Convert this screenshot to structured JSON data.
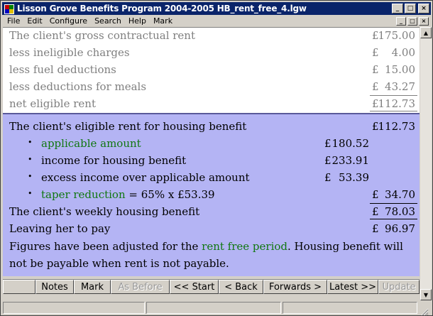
{
  "window": {
    "title": "Lisson Grove Benefits Program 2004-2005 HB_rent_free_4.lgw",
    "controls": {
      "minimize": "_",
      "maximize": "□",
      "close": "×"
    }
  },
  "menu": {
    "items": [
      "File",
      "Edit",
      "Configure",
      "Search",
      "Help",
      "Mark"
    ],
    "doc_controls": {
      "minimize": "_",
      "restore": "□",
      "close": "×"
    }
  },
  "rent_breakdown": {
    "rows": [
      {
        "label": "The client's gross contractual rent",
        "currency": "£",
        "amount": "175.00"
      },
      {
        "label": "less ineligible charges",
        "currency": "£",
        "amount": "4.00"
      },
      {
        "label": "less fuel deductions",
        "currency": "£",
        "amount": "15.00"
      },
      {
        "label": "less deductions for meals",
        "currency": "£",
        "amount": "43.27"
      },
      {
        "label": "net eligible rent",
        "currency": "£",
        "amount": "112.73"
      }
    ]
  },
  "benefit": {
    "eligible_rent": {
      "label": "The client's eligible rent for housing benefit",
      "currency": "£",
      "amount": "112.73"
    },
    "bullets": [
      {
        "bullet": "•",
        "label": "applicable amount",
        "currency": "£",
        "amount": "180.52"
      },
      {
        "bullet": "•",
        "label": "income for housing benefit",
        "currency": "£",
        "amount": "233.91"
      },
      {
        "bullet": "•",
        "label": "excess income over applicable amount",
        "currency": "£",
        "amount": "53.39"
      }
    ],
    "taper": {
      "bullet": "•",
      "label": "taper reduction",
      "formula": " = 65% x £53.39",
      "currency": "£",
      "amount": "34.70"
    },
    "weekly": {
      "label": "The client's weekly housing benefit",
      "currency": "£",
      "amount": "78.03"
    },
    "to_pay": {
      "label": "Leaving her to pay",
      "currency": "£",
      "amount": "96.97"
    },
    "note": {
      "pre": "Figures have been adjusted for the ",
      "link": "rent free period",
      "post": ".  Housing benefit will not be payable when rent is not payable."
    }
  },
  "buttons": {
    "notes": "Notes",
    "mark": "Mark",
    "as_before": "As Before",
    "start": "<< Start",
    "back": "< Back",
    "forwards": "Forwards >",
    "latest": "Latest >>",
    "update": "Update"
  },
  "scroll": {
    "up": "▲",
    "down": "▼"
  },
  "colors": {
    "titlebar": "#0a246a",
    "panel_lower": "#b4b4f4",
    "green_text": "#117711"
  }
}
